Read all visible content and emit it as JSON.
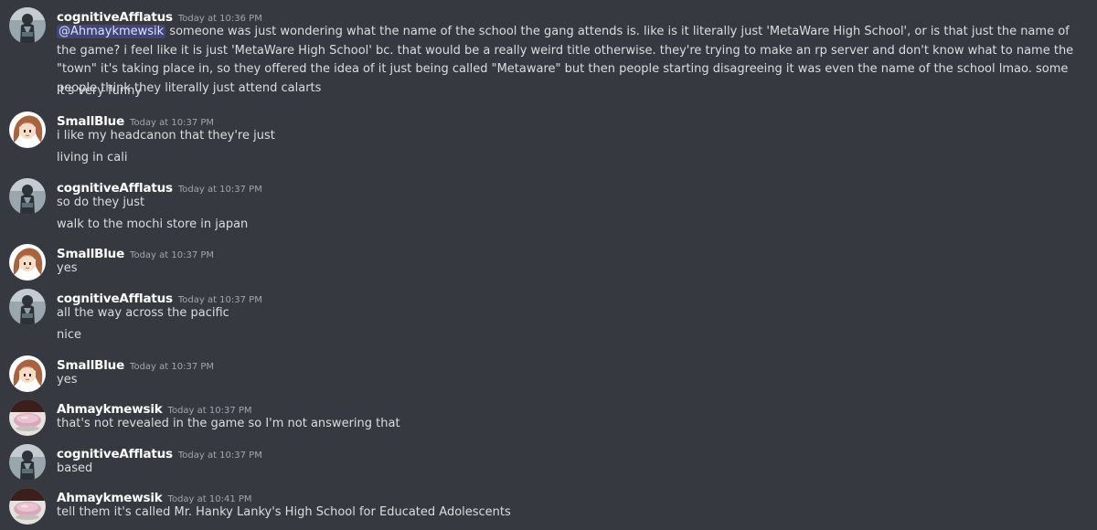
{
  "messages": [
    {
      "author": "cognitiveAfflatus",
      "timestamp": "Today at 10:36 PM",
      "avatar": "cognitive-avatar",
      "lines": [
        {
          "mention": "@Ahmaykmewsik",
          "text": " someone was just wondering what the name of the school the gang attends is. like is it literally just 'MetaWare High School', or is that just the name of the game? i feel like it is just 'MetaWare High School' bc. that would be a really weird title otherwise. they're trying to make an rp server and don't know what to name the \"town\" it's taking place in, so they offered the idea of it just being called \"Metaware\" but then people starting disagreeing it was even the name of the school lmao. some people think they literally just attend calarts"
        },
        {
          "text": "it's very funny"
        }
      ]
    },
    {
      "author": "SmallBlue",
      "timestamp": "Today at 10:37 PM",
      "avatar": "smallblue-avatar",
      "lines": [
        {
          "text": "i like my headcanon that they're just"
        },
        {
          "text": "living in cali"
        }
      ]
    },
    {
      "author": "cognitiveAfflatus",
      "timestamp": "Today at 10:37 PM",
      "avatar": "cognitive-avatar",
      "lines": [
        {
          "text": "so do they just"
        },
        {
          "text": "walk to the mochi store in japan"
        }
      ]
    },
    {
      "author": "SmallBlue",
      "timestamp": "Today at 10:37 PM",
      "avatar": "smallblue-avatar",
      "lines": [
        {
          "text": "yes"
        }
      ]
    },
    {
      "author": "cognitiveAfflatus",
      "timestamp": "Today at 10:37 PM",
      "avatar": "cognitive-avatar",
      "lines": [
        {
          "text": "all the way across the pacific"
        },
        {
          "text": "nice"
        }
      ]
    },
    {
      "author": "SmallBlue",
      "timestamp": "Today at 10:37 PM",
      "avatar": "smallblue-avatar",
      "lines": [
        {
          "text": "yes"
        }
      ]
    },
    {
      "author": "Ahmaykmewsik",
      "timestamp": "Today at 10:37 PM",
      "avatar": "ahmaykmewsik-avatar",
      "lines": [
        {
          "text": "that's not revealed in the game so I'm not answering that"
        }
      ]
    },
    {
      "author": "cognitiveAfflatus",
      "timestamp": "Today at 10:37 PM",
      "avatar": "cognitive-avatar",
      "lines": [
        {
          "text": "based"
        }
      ]
    },
    {
      "author": "Ahmaykmewsik",
      "timestamp": "Today at 10:41 PM",
      "avatar": "ahmaykmewsik-avatar",
      "lines": [
        {
          "text": "tell them it's called Mr. Hanky Lanky's High School for Educated Adolescents"
        }
      ]
    }
  ],
  "colors": {
    "background": "#36393f",
    "username": "#ffffff",
    "message_text": "#dcddde",
    "timestamp": "#a3a6aa",
    "mention_bg": "#4f5497",
    "mention_text": "#dee0fc"
  }
}
